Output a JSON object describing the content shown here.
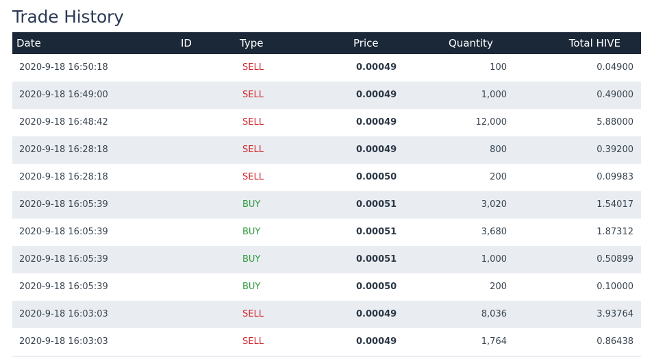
{
  "page": {
    "title": "Trade History"
  },
  "table": {
    "headers": {
      "date": "Date",
      "id": "ID",
      "type": "Type",
      "price": "Price",
      "quantity": "Quantity",
      "total": "Total HIVE"
    },
    "rows": [
      {
        "date": "2020-9-18 16:50:18",
        "id": "",
        "type": "SELL",
        "price": "0.00049",
        "quantity": "100",
        "total": "0.04900"
      },
      {
        "date": "2020-9-18 16:49:00",
        "id": "",
        "type": "SELL",
        "price": "0.00049",
        "quantity": "1,000",
        "total": "0.49000"
      },
      {
        "date": "2020-9-18 16:48:42",
        "id": "",
        "type": "SELL",
        "price": "0.00049",
        "quantity": "12,000",
        "total": "5.88000"
      },
      {
        "date": "2020-9-18 16:28:18",
        "id": "",
        "type": "SELL",
        "price": "0.00049",
        "quantity": "800",
        "total": "0.39200"
      },
      {
        "date": "2020-9-18 16:28:18",
        "id": "",
        "type": "SELL",
        "price": "0.00050",
        "quantity": "200",
        "total": "0.09983"
      },
      {
        "date": "2020-9-18 16:05:39",
        "id": "",
        "type": "BUY",
        "price": "0.00051",
        "quantity": "3,020",
        "total": "1.54017"
      },
      {
        "date": "2020-9-18 16:05:39",
        "id": "",
        "type": "BUY",
        "price": "0.00051",
        "quantity": "3,680",
        "total": "1.87312"
      },
      {
        "date": "2020-9-18 16:05:39",
        "id": "",
        "type": "BUY",
        "price": "0.00051",
        "quantity": "1,000",
        "total": "0.50899"
      },
      {
        "date": "2020-9-18 16:05:39",
        "id": "",
        "type": "BUY",
        "price": "0.00050",
        "quantity": "200",
        "total": "0.10000"
      },
      {
        "date": "2020-9-18 16:03:03",
        "id": "",
        "type": "SELL",
        "price": "0.00049",
        "quantity": "8,036",
        "total": "3.93764"
      },
      {
        "date": "2020-9-18 16:03:03",
        "id": "",
        "type": "SELL",
        "price": "0.00049",
        "quantity": "1,764",
        "total": "0.86438"
      }
    ]
  },
  "colors": {
    "header_bg": "#1b2838",
    "title": "#2b3a55",
    "sell": "#d0262b",
    "buy": "#2e9a3e",
    "alt_row": "#e9edf1"
  }
}
